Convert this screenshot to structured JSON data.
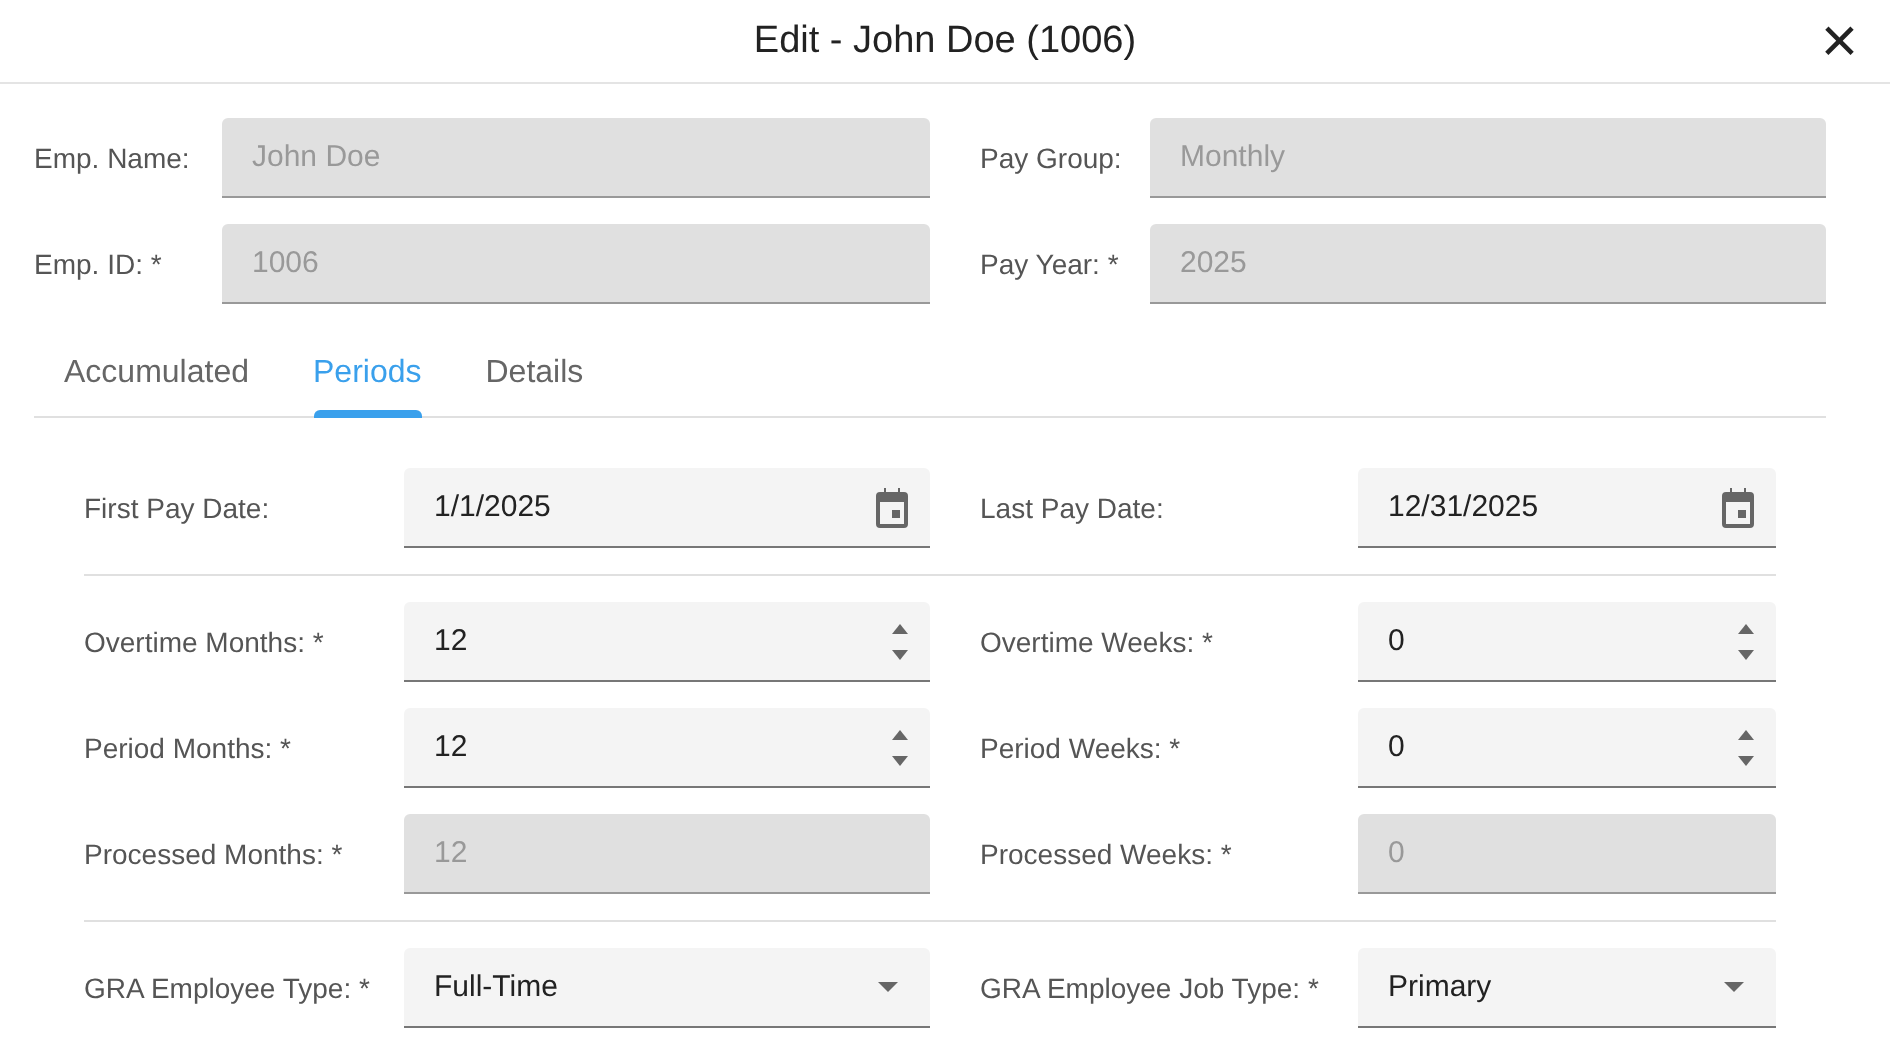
{
  "window": {
    "title": "Edit - John Doe (1006)",
    "close": "×"
  },
  "header_fields": [
    {
      "label": "Emp. Name:",
      "value": "John Doe",
      "disabled": true
    },
    {
      "label": "Pay Group:",
      "value": "Monthly",
      "disabled": true
    },
    {
      "label": "Emp. ID: *",
      "value": "1006",
      "disabled": true
    },
    {
      "label": "Pay Year: *",
      "value": "2025",
      "disabled": true
    }
  ],
  "tabs": [
    {
      "label": "Accumulated",
      "selected": false
    },
    {
      "label": "Periods",
      "selected": true
    },
    {
      "label": "Details",
      "selected": false
    }
  ],
  "sections": [
    {
      "fields": [
        {
          "label": "First Pay Date:",
          "value": "1/1/2025",
          "kind": "date",
          "disabled": false
        },
        {
          "label": "Last Pay Date:",
          "value": "12/31/2025",
          "kind": "date",
          "disabled": false
        }
      ]
    },
    {
      "fields": [
        {
          "label": "Overtime Months: *",
          "value": "12",
          "kind": "number",
          "disabled": false
        },
        {
          "label": "Overtime Weeks: *",
          "value": "0",
          "kind": "number",
          "disabled": false
        },
        {
          "label": "Period Months: *",
          "value": "12",
          "kind": "number",
          "disabled": false
        },
        {
          "label": "Period Weeks: *",
          "value": "0",
          "kind": "number",
          "disabled": false
        },
        {
          "label": "Processed Months: *",
          "value": "12",
          "kind": "text",
          "disabled": true
        },
        {
          "label": "Processed Weeks: *",
          "value": "0",
          "kind": "text",
          "disabled": true
        }
      ]
    },
    {
      "fields": [
        {
          "label": "GRA Employee Type: *",
          "value": "Full-Time",
          "kind": "select",
          "disabled": false
        },
        {
          "label": "GRA Employee Job Type: *",
          "value": "Primary",
          "kind": "select",
          "disabled": false
        }
      ]
    }
  ]
}
